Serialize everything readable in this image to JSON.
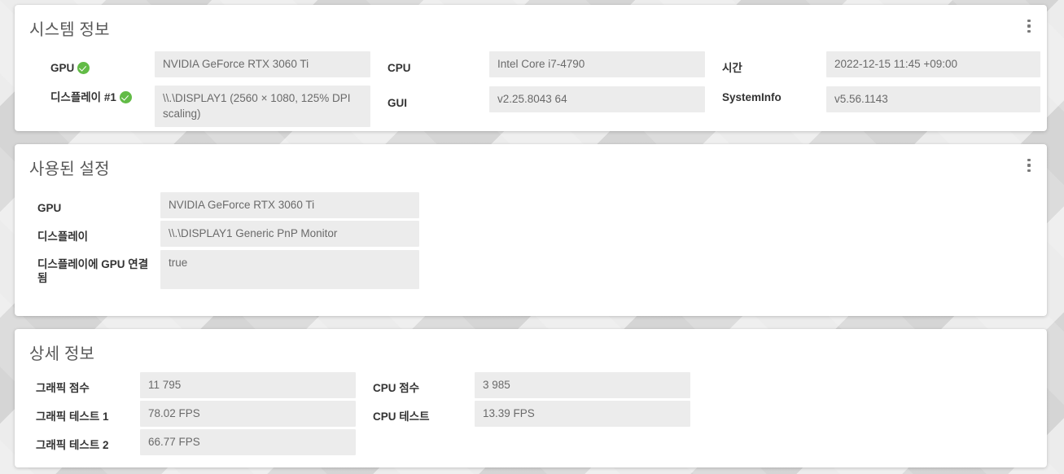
{
  "cards": {
    "system": {
      "title": "시스템 정보",
      "menu_icon": "kebab-menu-icon",
      "fields": {
        "gpu": {
          "label": "GPU",
          "value": "NVIDIA GeForce RTX 3060 Ti",
          "status": "ok"
        },
        "display1": {
          "label": "디스플레이 #1",
          "value": "\\\\.\\DISPLAY1 (2560 × 1080, 125% DPI scaling)",
          "status": "ok"
        },
        "cpu": {
          "label": "CPU",
          "value": "Intel Core i7-4790"
        },
        "gui": {
          "label": "GUI",
          "value": "v2.25.8043 64"
        },
        "time": {
          "label": "시간",
          "value": "2022-12-15 11:45 +09:00"
        },
        "systeminfo": {
          "label": "SystemInfo",
          "value": "v5.56.1143"
        }
      }
    },
    "settings": {
      "title": "사용된 설정",
      "menu_icon": "kebab-menu-icon",
      "fields": {
        "gpu": {
          "label": "GPU",
          "value": "NVIDIA GeForce RTX 3060 Ti"
        },
        "display": {
          "label": "디스플레이",
          "value": "\\\\.\\DISPLAY1 Generic PnP Monitor"
        },
        "gpu_attached": {
          "label": "디스플레이에 GPU 연결됨",
          "value": "true"
        }
      }
    },
    "details": {
      "title": "상세 정보",
      "fields": {
        "graphics_score": {
          "label": "그래픽 점수",
          "value": "11 795"
        },
        "graphics_test1": {
          "label": "그래픽 테스트 1",
          "value": "78.02 FPS"
        },
        "graphics_test2": {
          "label": "그래픽 테스트 2",
          "value": "66.77 FPS"
        },
        "cpu_score": {
          "label": "CPU 점수",
          "value": "3 985"
        },
        "cpu_test": {
          "label": "CPU 테스트",
          "value": "13.39 FPS"
        }
      }
    }
  },
  "colors": {
    "status_ok": "#62bb46",
    "card_bg": "#ffffff",
    "value_bg": "#ececec",
    "label_text": "#333333",
    "value_text": "#6a6a6a",
    "title_text": "#585858",
    "page_bg": "#dcdcdc"
  }
}
